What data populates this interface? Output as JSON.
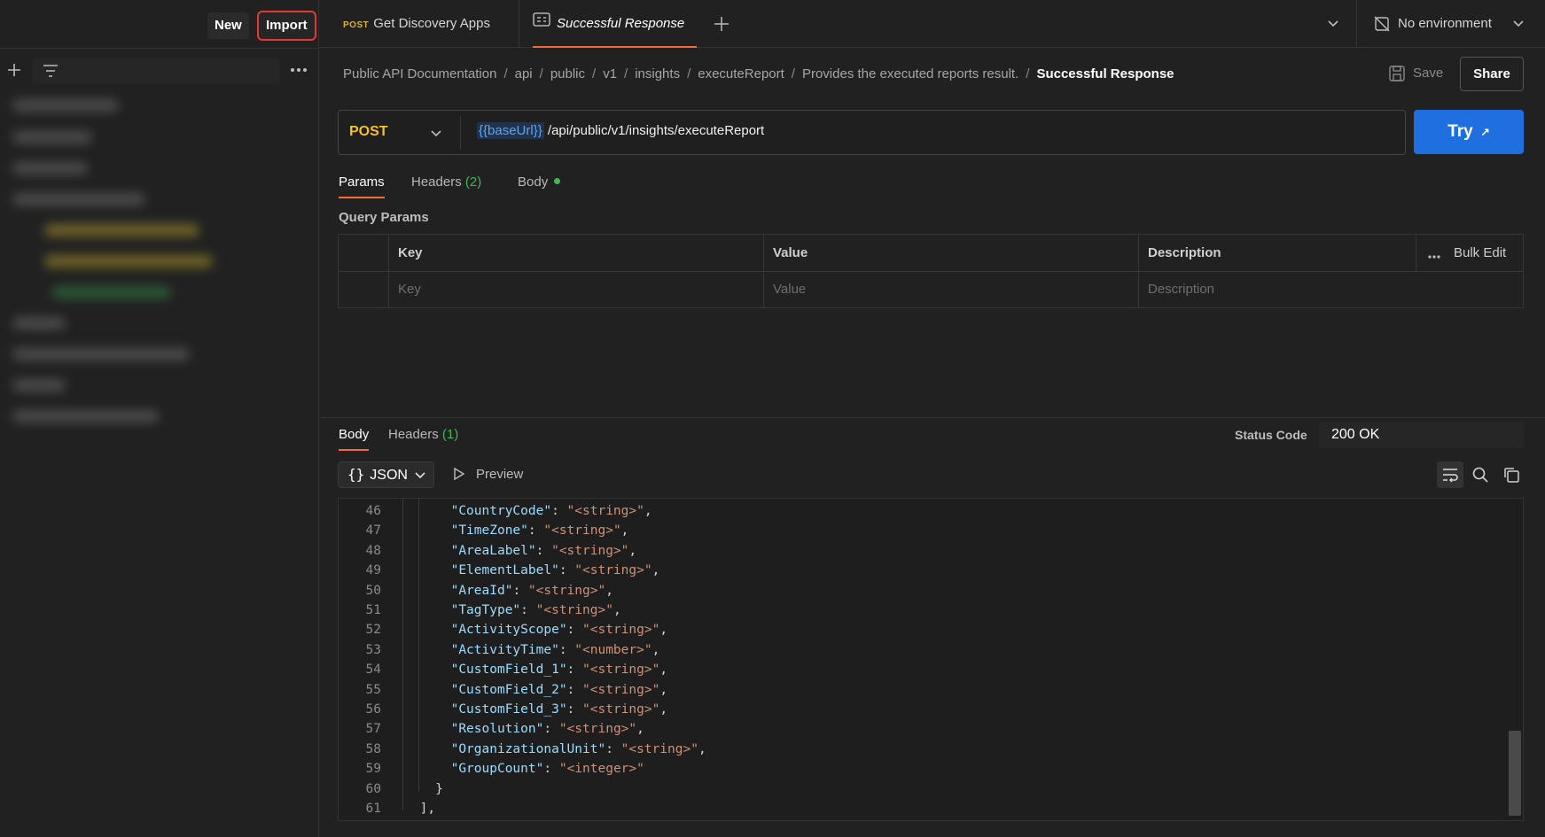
{
  "sidebar": {
    "new_label": "New",
    "import_label": "Import"
  },
  "tabs": [
    {
      "method": "POST",
      "label": "Get Discovery Apps"
    },
    {
      "label": "Successful Response"
    }
  ],
  "environment": {
    "label": "No environment"
  },
  "breadcrumb": {
    "items": [
      "Public API Documentation",
      "api",
      "public",
      "v1",
      "insights",
      "executeReport",
      "Provides the executed reports result."
    ],
    "current": "Successful Response"
  },
  "actions": {
    "save_label": "Save",
    "share_label": "Share"
  },
  "request": {
    "method": "POST",
    "url_variable": "{{baseUrl}}",
    "url_path": "/api/public/v1/insights/executeReport",
    "try_label": "Try",
    "try_icon": "↗"
  },
  "request_tabs": {
    "params": "Params",
    "headers": "Headers",
    "headers_count": "(2)",
    "body": "Body"
  },
  "query_params": {
    "title": "Query Params",
    "columns": {
      "key": "Key",
      "value": "Value",
      "description": "Description"
    },
    "bulk_edit": "Bulk Edit",
    "placeholders": {
      "key": "Key",
      "value": "Value",
      "description": "Description"
    }
  },
  "response": {
    "tabs": {
      "body": "Body",
      "headers": "Headers",
      "headers_count": "(1)"
    },
    "status_label": "Status Code",
    "status_value": "200 OK",
    "format": "JSON",
    "preview_label": "Preview",
    "lines": [
      {
        "n": "46",
        "key": "CountryCode",
        "val": "<string>",
        "comma": ","
      },
      {
        "n": "47",
        "key": "TimeZone",
        "val": "<string>",
        "comma": ","
      },
      {
        "n": "48",
        "key": "AreaLabel",
        "val": "<string>",
        "comma": ","
      },
      {
        "n": "49",
        "key": "ElementLabel",
        "val": "<string>",
        "comma": ","
      },
      {
        "n": "50",
        "key": "AreaId",
        "val": "<string>",
        "comma": ","
      },
      {
        "n": "51",
        "key": "TagType",
        "val": "<string>",
        "comma": ","
      },
      {
        "n": "52",
        "key": "ActivityScope",
        "val": "<string>",
        "comma": ","
      },
      {
        "n": "53",
        "key": "ActivityTime",
        "val": "<number>",
        "comma": ","
      },
      {
        "n": "54",
        "key": "CustomField_1",
        "val": "<string>",
        "comma": ","
      },
      {
        "n": "55",
        "key": "CustomField_2",
        "val": "<string>",
        "comma": ","
      },
      {
        "n": "56",
        "key": "CustomField_3",
        "val": "<string>",
        "comma": ","
      },
      {
        "n": "57",
        "key": "Resolution",
        "val": "<string>",
        "comma": ","
      },
      {
        "n": "58",
        "key": "OrganizationalUnit",
        "val": "<string>",
        "comma": ","
      },
      {
        "n": "59",
        "key": "GroupCount",
        "val": "<integer>",
        "comma": ""
      }
    ],
    "closing_lines": [
      {
        "n": "60",
        "text": "}"
      },
      {
        "n": "61",
        "text": "],"
      }
    ]
  },
  "colors": {
    "accent": "#f26b3a",
    "primary": "#1f6fe0",
    "method": "#f5c02b",
    "count": "#3fb950"
  }
}
